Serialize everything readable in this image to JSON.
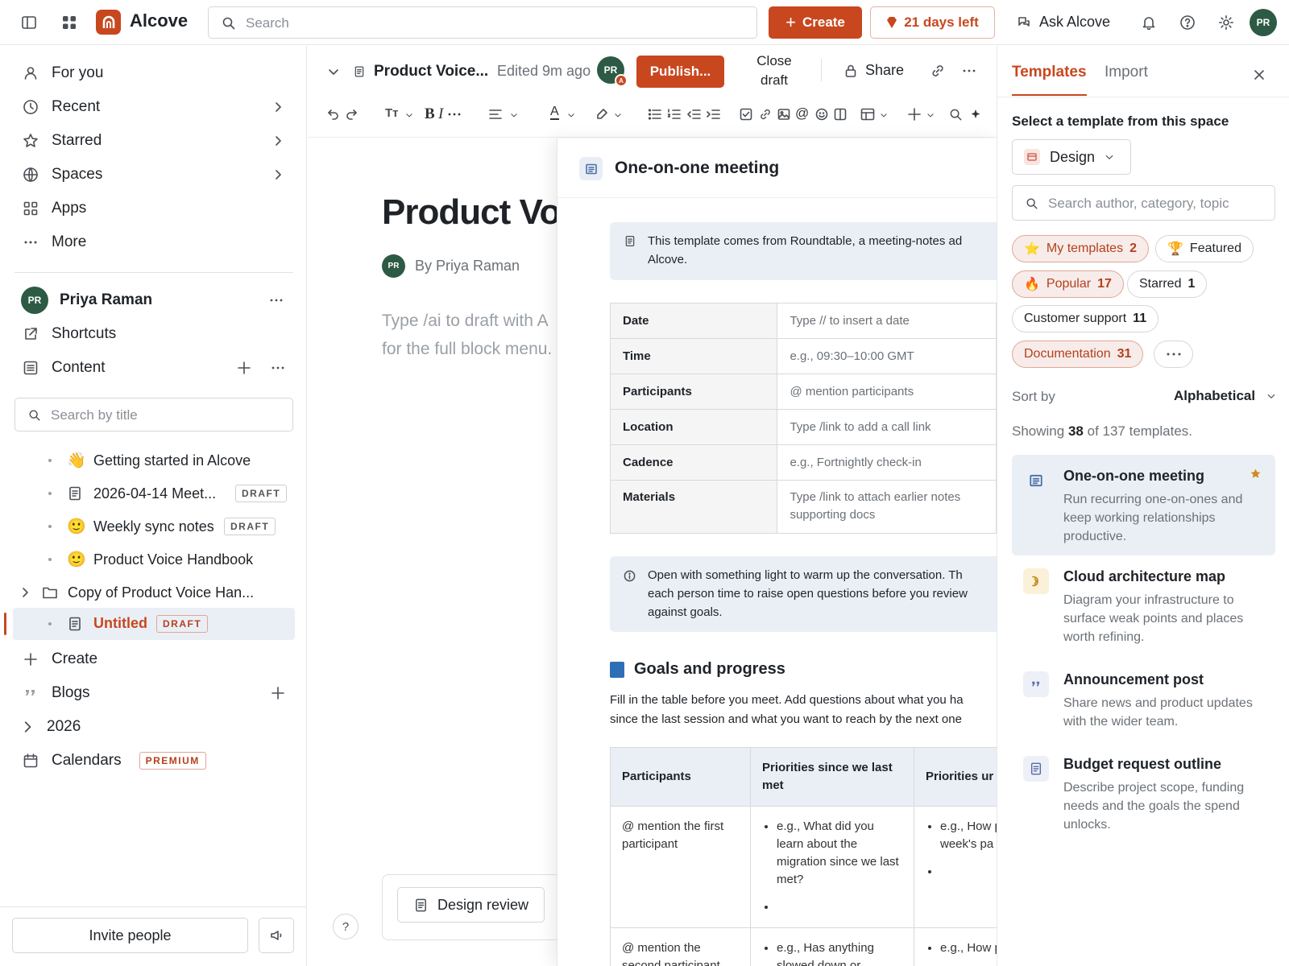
{
  "topbar": {
    "app_name": "Alcove",
    "search_placeholder": "Search",
    "create_label": "Create",
    "trial_label": "21 days left",
    "ask_label": "Ask Alcove",
    "avatar_initials": "PR"
  },
  "sidebar": {
    "nav": [
      {
        "label": "For you",
        "icon": "person-icon"
      },
      {
        "label": "Recent",
        "icon": "clock-icon"
      },
      {
        "label": "Starred",
        "icon": "star-icon"
      },
      {
        "label": "Spaces",
        "icon": "globe-icon"
      },
      {
        "label": "Apps",
        "icon": "apps-icon"
      },
      {
        "label": "More",
        "icon": "more-icon"
      }
    ],
    "space_name": "Priya Raman",
    "space_avatar": "PR",
    "shortcuts_label": "Shortcuts",
    "content_label": "Content",
    "search_placeholder": "Search by title",
    "tree": [
      {
        "emoji": "👋",
        "label": "Getting started in Alcove",
        "badge": ""
      },
      {
        "emoji": "",
        "label": "2026-04-14 Meet...",
        "badge": "DRAFT"
      },
      {
        "emoji": "🙂",
        "label": "Weekly sync notes",
        "badge": "DRAFT"
      },
      {
        "emoji": "🙂",
        "label": "Product Voice Handbook",
        "badge": ""
      },
      {
        "emoji": "",
        "label": "Copy of Product Voice Han...",
        "badge": ""
      },
      {
        "emoji": "",
        "label": "Untitled",
        "badge": "DRAFT"
      }
    ],
    "create_label": "Create",
    "blogs_label": "Blogs",
    "year_label": "2026",
    "calendars_label": "Calendars",
    "premium_badge": "PREMIUM",
    "invite_label": "Invite people"
  },
  "editor": {
    "doc_title_short": "Product Voice...",
    "edited": "Edited 9m ago",
    "avatar": "PR",
    "avatar_sub": "A",
    "publish_label": "Publish...",
    "close_line1": "Close",
    "close_line2": "draft",
    "share_label": "Share",
    "page_title": "Product Voi",
    "author": "By Priya Raman",
    "placeholder_line1": "Type /ai to draft with A",
    "placeholder_line2": "for the full block menu.",
    "footer_chip": "Design review",
    "help": "?"
  },
  "preview": {
    "title": "One-on-one meeting",
    "intro_line1": "This template comes from Roundtable, a meeting-notes ad",
    "intro_line2": "Alcove.",
    "rows": [
      {
        "k": "Date",
        "v": "Type // to insert a date"
      },
      {
        "k": "Time",
        "v": "e.g., 09:30–10:00 GMT"
      },
      {
        "k": "Participants",
        "v": "@ mention participants"
      },
      {
        "k": "Location",
        "v": "Type /link to add a call link"
      },
      {
        "k": "Cadence",
        "v": "e.g., Fortnightly check-in"
      },
      {
        "k": "Materials",
        "v1": "Type /link to attach earlier notes",
        "v2": "supporting docs"
      }
    ],
    "tip_line1": "Open with something light to warm up the conversation. Th",
    "tip_line2": "each person time to raise open questions before you review",
    "tip_line3": "against goals.",
    "goals_heading": "Goals and progress",
    "goals_line1": "Fill in the table before you meet. Add questions about what you ha",
    "goals_line2": "since the last session and what you want to reach by the next one",
    "col1": "Participants",
    "col2": "Priorities since we last met",
    "col3": "Priorities ur again",
    "r1c1": "@ mention the first participant",
    "r1c2": "e.g., What did you learn about the migration since we last met?",
    "r1c3": "e.g., How prepare fo week's pa review?",
    "r2c1": "@ mention the second participant",
    "r2c2": "e.g., Has anything slowed down or",
    "r2c3": "e.g., How progress"
  },
  "templates": {
    "tab_active": "Templates",
    "tab_import": "Import",
    "subtitle": "Select a template from this space",
    "space_select": "Design",
    "search_placeholder": "Search author, category, topic",
    "chips": [
      {
        "emoji": "⭐",
        "label": "My templates",
        "count": "2",
        "selected": true
      },
      {
        "emoji": "🏆",
        "label": "Featured",
        "count": "",
        "selected": false
      },
      {
        "emoji": "🔥",
        "label": "Popular",
        "count": "17",
        "selected": true
      },
      {
        "emoji": "",
        "label": "Starred",
        "count": "1",
        "selected": false
      },
      {
        "emoji": "",
        "label": "Customer support",
        "count": "11",
        "selected": false
      },
      {
        "emoji": "",
        "label": "Documentation",
        "count": "31",
        "selected": true
      }
    ],
    "sort_label": "Sort by",
    "sort_value": "Alphabetical",
    "showing_prefix": "Showing",
    "showing_count": "38",
    "showing_suffix": "of 137 templates.",
    "items": [
      {
        "title": "One-on-one meeting",
        "desc": "Run recurring one-on-ones and keep working relationships productive.",
        "icon": "document-icon"
      },
      {
        "title": "Cloud architecture map",
        "desc": "Diagram your infrastructure to surface weak points and places worth refining.",
        "icon": "architecture-icon"
      },
      {
        "title": "Announcement post",
        "desc": "Share news and product updates with the wider team.",
        "icon": "quote-icon"
      },
      {
        "title": "Budget request outline",
        "desc": "Describe project scope, funding needs and the goals the spend unlocks.",
        "icon": "document-icon"
      }
    ]
  },
  "colors": {
    "accent": "#c8471f",
    "avatar": "#2d5a45",
    "selected_bg": "#eaeff6"
  }
}
